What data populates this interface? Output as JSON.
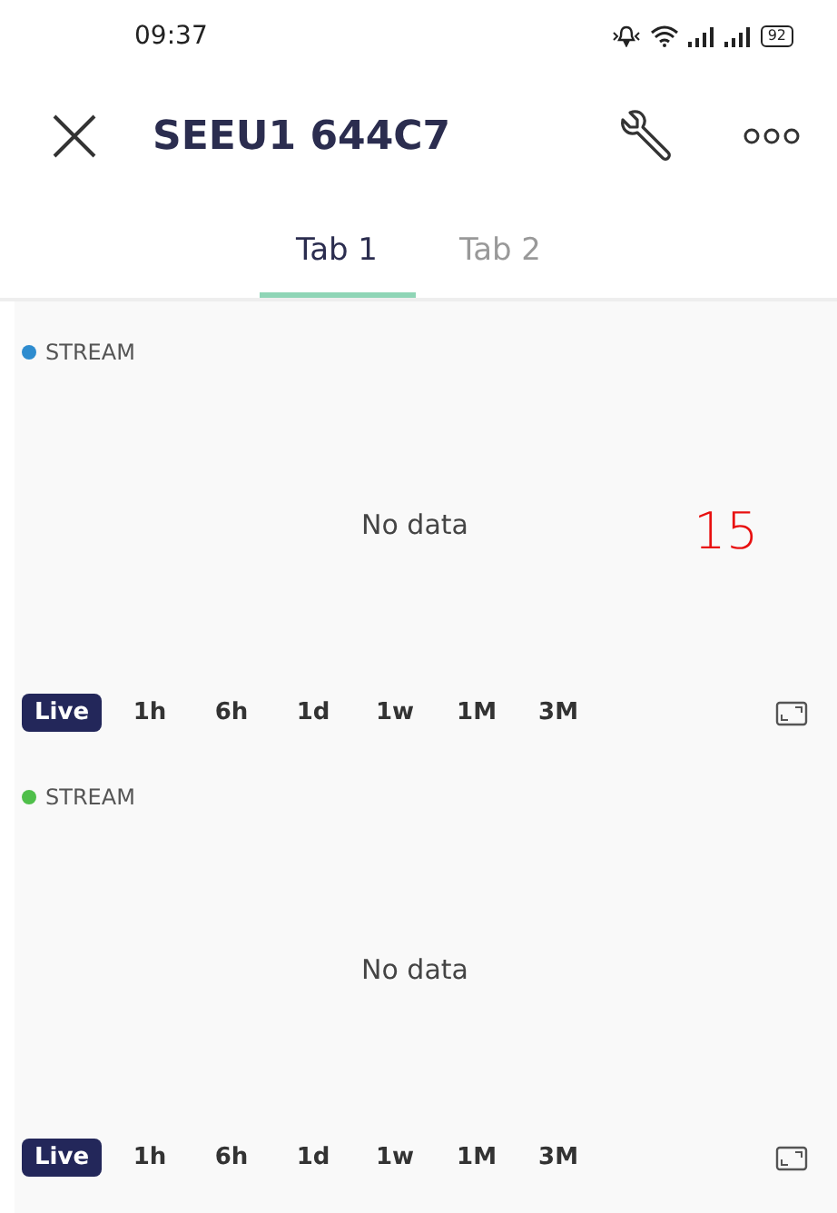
{
  "status_bar": {
    "time": "09:37",
    "battery": "92"
  },
  "header": {
    "title": "SEEU1 644C7"
  },
  "tabs": [
    {
      "label": "Tab 1",
      "selected": true
    },
    {
      "label": "Tab 2",
      "selected": false
    }
  ],
  "widgets": [
    {
      "legend": {
        "label": "STREAM",
        "color": "#2e8ccf"
      },
      "message": "No data",
      "overlay_number": "15",
      "ranges": [
        {
          "label": "Live",
          "selected": true
        },
        {
          "label": "1h",
          "selected": false
        },
        {
          "label": "6h",
          "selected": false
        },
        {
          "label": "1d",
          "selected": false
        },
        {
          "label": "1w",
          "selected": false
        },
        {
          "label": "1M",
          "selected": false
        },
        {
          "label": "3M",
          "selected": false
        }
      ]
    },
    {
      "legend": {
        "label": "STREAM",
        "color": "#4fbf4a"
      },
      "message": "No data",
      "ranges": [
        {
          "label": "Live",
          "selected": true
        },
        {
          "label": "1h",
          "selected": false
        },
        {
          "label": "6h",
          "selected": false
        },
        {
          "label": "1d",
          "selected": false
        },
        {
          "label": "1w",
          "selected": false
        },
        {
          "label": "1M",
          "selected": false
        },
        {
          "label": "3M",
          "selected": false
        }
      ]
    }
  ]
}
